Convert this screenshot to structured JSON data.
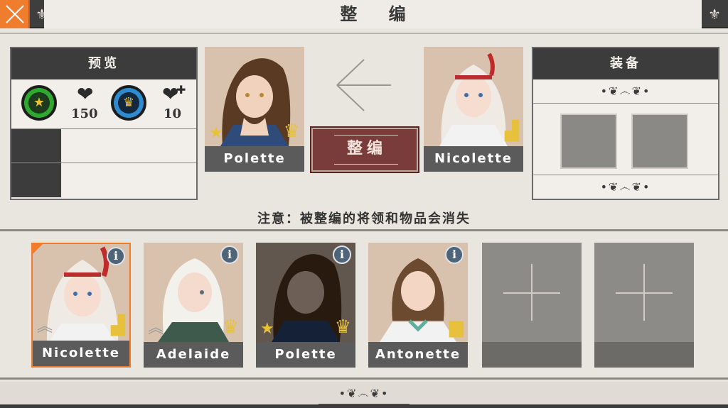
{
  "header": {
    "title": "整 编",
    "close_icon": "close-x-icon",
    "accent": "#f07c2e"
  },
  "preview_panel": {
    "title": "预览",
    "stats": [
      {
        "icon": "rank-star-badge-icon",
        "color": "#2fa82f"
      },
      {
        "icon": "heart-icon",
        "value": "150"
      },
      {
        "icon": "crown-badge-icon",
        "color": "#2f8bd0"
      },
      {
        "icon": "heart-plus-icon",
        "value": "10"
      }
    ]
  },
  "merge": {
    "source_name": "Polette",
    "target_name": "Nicolette",
    "button_label": "整编",
    "arrow_icon": "arrow-left-icon"
  },
  "equipment_panel": {
    "title": "装备"
  },
  "notice": "注意：被整编的将领和物品会消失",
  "roster": [
    {
      "name": "Nicolette",
      "selected": true
    },
    {
      "name": "Adelaide",
      "selected": false
    },
    {
      "name": "Polette",
      "selected": false,
      "dimmed": true
    },
    {
      "name": "Antonette",
      "selected": false
    }
  ],
  "empty_slots": 2,
  "colors": {
    "dark": "#3c3c3c",
    "button": "#7a3b3b",
    "bg": "#e9e5df"
  }
}
